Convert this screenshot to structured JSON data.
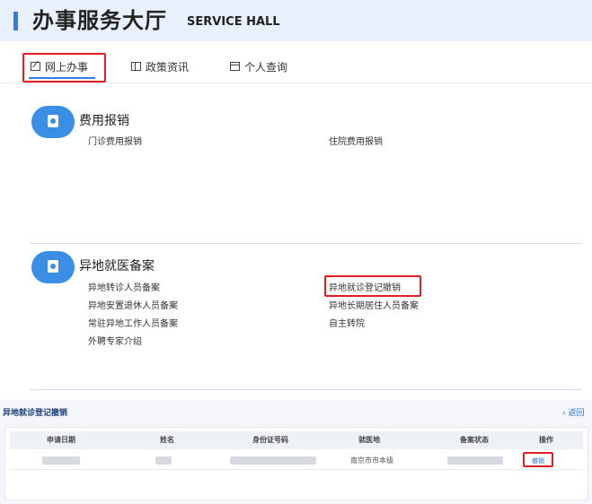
{
  "header": {
    "title": "办事服务大厅",
    "subtitle": "SERVICE HALL"
  },
  "tabs": [
    {
      "label": "网上办事",
      "icon": "edit-icon",
      "active": true
    },
    {
      "label": "政策资讯",
      "icon": "book-icon",
      "active": false
    },
    {
      "label": "个人查询",
      "icon": "calendar-icon",
      "active": false
    }
  ],
  "sections": [
    {
      "title": "费用报销",
      "icon": "document-icon",
      "items": [
        "门诊费用报销",
        "住院费用报销"
      ]
    },
    {
      "title": "异地就医备案",
      "icon": "medical-kit-icon",
      "items": [
        "异地转诊人员备案",
        "异地就诊登记撤销",
        "异地安置退休人员备案",
        "异地长期居住人员备案",
        "常驻异地工作人员备案",
        "自主转院",
        "外聘专家介绍"
      ]
    }
  ],
  "panel": {
    "title": "异地就诊登记撤销",
    "back_label": "‹ 返回",
    "columns": [
      "申请日期",
      "姓名",
      "身份证号码",
      "就医地",
      "备案状态",
      "操作"
    ],
    "rows": [
      {
        "hospital_place": "南京市市本级",
        "action": "撤销"
      }
    ]
  },
  "colors": {
    "accent": "#2f7de1",
    "highlight_box": "#e02020",
    "header_bg": "#e8f1fb"
  }
}
